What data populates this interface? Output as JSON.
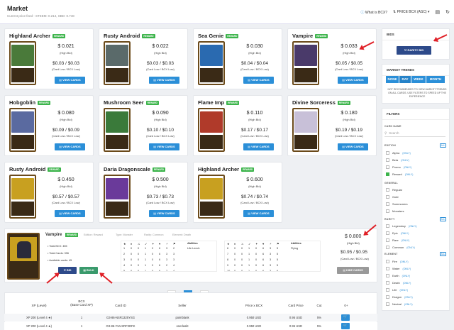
{
  "header": {
    "title": "Market",
    "subtitle": "Current price feed - STEEM: 0.214, SBD: 0.748",
    "help_label": "What is BCX?",
    "sort_label": "PRICE BCX (ASC)"
  },
  "cards": [
    {
      "name": "Highland Archer",
      "badge": "REWARD",
      "price": "$ 0.021",
      "price_label": "(High Bid)",
      "card_low": "$0.03 / $0.03",
      "card_low_label": "(Card Low / BCX Low)",
      "button": "VIEW CARDS",
      "color": "#4a7a3a"
    },
    {
      "name": "Rusty Android",
      "badge": "REWARD",
      "price": "$ 0.022",
      "price_label": "(High Bid)",
      "card_low": "$0.03 / $0.03",
      "card_low_label": "(Card Low / BCX Low)",
      "button": "VIEW CARDS",
      "color": "#5a6a6a"
    },
    {
      "name": "Sea Genie",
      "badge": "REWARD",
      "price": "$ 0.030",
      "price_label": "(High Bid)",
      "card_low": "$0.04 / $0.04",
      "card_low_label": "(Card Low / BCX Low)",
      "button": "VIEW CARDS",
      "color": "#2a6ab0"
    },
    {
      "name": "Vampire",
      "badge": "REWARD",
      "price": "$ 0.033",
      "price_label": "(High Bid)",
      "card_low": "$0.05 / $0.05",
      "card_low_label": "(Card Low / BCX Low)",
      "button": "VIEW CARDS",
      "color": "#4a3a6a"
    },
    {
      "name": "Hobgoblin",
      "badge": "REWARD",
      "price": "$ 0.080",
      "price_label": "(High Bid)",
      "card_low": "$0.09 / $0.09",
      "card_low_label": "(Card Low / BCX Low)",
      "button": "VIEW CARDS",
      "color": "#5a6aa0"
    },
    {
      "name": "Mushroom Seer",
      "badge": "REWARD",
      "price": "$ 0.090",
      "price_label": "(High Bid)",
      "card_low": "$0.10 / $0.10",
      "card_low_label": "(Card Low / BCX Low)",
      "button": "VIEW CARDS",
      "color": "#3a7a3a"
    },
    {
      "name": "Flame Imp",
      "badge": "REWARD",
      "price": "$ 0.110",
      "price_label": "(High Bid)",
      "card_low": "$0.17 / $0.17",
      "card_low_label": "(Card Low / BCX Low)",
      "button": "VIEW CARDS",
      "color": "#b03a2a"
    },
    {
      "name": "Divine Sorceress",
      "badge": "REWARD",
      "price": "$ 0.180",
      "price_label": "(High Bid)",
      "card_low": "$0.19 / $0.19",
      "card_low_label": "(Card Low / BCX Low)",
      "button": "VIEW CARDS",
      "color": "#c8c0d8"
    },
    {
      "name": "Rusty Android",
      "badge": "REWARD",
      "price": "$ 0.450",
      "price_label": "(High Bid)",
      "card_low": "$0.57 / $0.57",
      "card_low_label": "(Card Low / BCX Low)",
      "button": "VIEW CARDS",
      "color": "#c8a020"
    },
    {
      "name": "Daria Dragonscale",
      "badge": "REWARD",
      "price": "$ 0.500",
      "price_label": "(High Bid)",
      "card_low": "$0.73 / $0.73",
      "card_low_label": "(Card Low / BCX Low)",
      "button": "VIEW CARDS",
      "color": "#6a3a9a"
    },
    {
      "name": "Highland Archer",
      "badge": "REWARD",
      "price": "$ 0.600",
      "price_label": "(High Bid)",
      "card_low": "$0.74 / $0.74",
      "card_low_label": "(Card Low / BCX Low)",
      "button": "VIEW CARDS",
      "color": "#c8a020"
    }
  ],
  "bids": {
    "title": "BIDS",
    "button": "RARITY BID"
  },
  "trends": {
    "title": "MARKET TRENDS",
    "tabs": [
      "NONE",
      "DAY",
      "WEEK",
      "MONTH"
    ],
    "note": "NOT RECOMMENDED TO VIEW MARKET TRENDS ON ALL CARDS. USE FILTERS TO SPEED UP THE EXPERIENCE"
  },
  "filters": {
    "title": "FILTERS",
    "card_name_label": "CARD NAME",
    "search_placeholder": "Search",
    "all_label": "ALL",
    "edition_label": "EDITION",
    "editions": [
      {
        "label": "Alpha",
        "only": "(ONLY)",
        "checked": false
      },
      {
        "label": "Beta",
        "only": "(ONLY)",
        "checked": false
      },
      {
        "label": "Promo",
        "only": "(ONLY)",
        "checked": false
      },
      {
        "label": "Reward",
        "only": "(ONLY)",
        "checked": true
      }
    ],
    "general_label": "GENERAL",
    "general": [
      "Regular",
      "Gold",
      "Summoners",
      "Monsters"
    ],
    "rarity_label": "RARITY",
    "rarities": [
      {
        "label": "Legendary",
        "only": "(ONLY)"
      },
      {
        "label": "Epic",
        "only": "(ONLY)"
      },
      {
        "label": "Rare",
        "only": "(ONLY)"
      },
      {
        "label": "Common",
        "only": "(ONLY)"
      }
    ],
    "element_label": "ELEMENT",
    "elements": [
      {
        "label": "Fire",
        "only": "(ONLY)"
      },
      {
        "label": "Water",
        "only": "(ONLY)"
      },
      {
        "label": "Earth",
        "only": "(ONLY)"
      },
      {
        "label": "Death",
        "only": "(ONLY)"
      },
      {
        "label": "Life",
        "only": "(ONLY)"
      },
      {
        "label": "Dragon",
        "only": "(ONLY)"
      },
      {
        "label": "Neutral",
        "only": "(ONLY)"
      }
    ]
  },
  "detail": {
    "name": "Vampire",
    "badge": "REWARD",
    "meta": [
      "Edition: Reward",
      "Type: Monster",
      "Rarity: Common",
      "Element: Death"
    ],
    "total_bcx": "Total BCX: 455",
    "total_cards": "Total Cards: 396",
    "available": "Available cards: 45",
    "bid_button": "BID",
    "bulk_button": "BULK",
    "price": "$ 0.800",
    "price_label": "(High Bid)",
    "card_low": "$0.95 / $0.95",
    "card_low_label": "(Card Low / BCX Low)",
    "hide_button": "HIDE CARDS",
    "stats_a": {
      "abilities_header": "Abilities",
      "rows": [
        [
          "1",
          "0",
          "0",
          "1",
          "0",
          "6",
          "3",
          "2",
          "Life Leech"
        ],
        [
          "2",
          "0",
          "0",
          "1",
          "0",
          "6",
          "3",
          "3",
          ""
        ],
        [
          "3",
          "0",
          "0",
          "1",
          "0",
          "6",
          "3",
          "3",
          ""
        ],
        [
          "4",
          "0",
          "0",
          "1",
          "0",
          "6",
          "2",
          "4",
          ""
        ],
        [
          "5",
          "0",
          "0",
          "1",
          "0",
          "6",
          "2",
          "4",
          ""
        ]
      ]
    },
    "stats_b": {
      "abilities_header": "Abilities",
      "rows": [
        [
          "6",
          "0",
          "0",
          "1",
          "0",
          "6",
          "3",
          "5",
          "Flying"
        ],
        [
          "7",
          "0",
          "0",
          "1",
          "0",
          "6",
          "3",
          "5",
          ""
        ],
        [
          "8",
          "0",
          "0",
          "1",
          "0",
          "6",
          "3",
          "5",
          ""
        ],
        [
          "9",
          "0",
          "0",
          "1",
          "0",
          "6",
          "3",
          "5",
          ""
        ],
        [
          "10",
          "0",
          "0",
          "1",
          "0",
          "6",
          "3",
          "6",
          ""
        ]
      ]
    }
  },
  "pagination": {
    "prev": "←",
    "page": "1",
    "next": "→"
  },
  "table": {
    "headers": [
      "XP (Level)",
      "BCX\n(Base Card XP)",
      "Card ID",
      "Seller",
      "Price x BCX",
      "Card Price",
      "Cut",
      "0+"
    ],
    "rows": [
      [
        "XP 200 (Level 4 ★)",
        "1",
        "G3-86-NSR1325YSG",
        "poimblank",
        "0.950 USD",
        "0.95 USD",
        "5%"
      ],
      [
        "XP 200 (Level 4 ★)",
        "1",
        "G3-86-YUUXRF2DFK",
        "onerlaskt",
        "0.950 USD",
        "0.95 USD",
        "5%"
      ]
    ]
  }
}
